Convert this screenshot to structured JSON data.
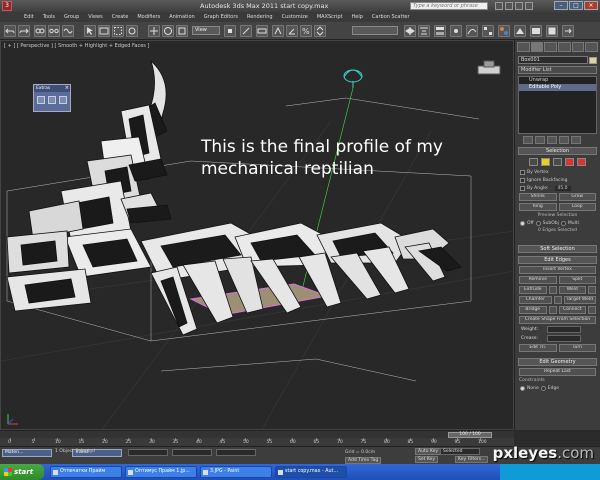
{
  "titlebar": {
    "title": "Autodesk 3ds Max  2011      start copy.max",
    "search_placeholder": "Type a keyword or phrase"
  },
  "menubar": {
    "items": [
      "Edit",
      "Tools",
      "Group",
      "Views",
      "Create",
      "Modifiers",
      "Animation",
      "Graph Editors",
      "Rendering",
      "Customize",
      "MAXScript",
      "Help",
      "Carbon Scatter"
    ]
  },
  "toolbar": {
    "view_dropdown": "View"
  },
  "viewport": {
    "label": "[ + ] [ Perspective ] [ Smooth + Highlight + Edged Faces ]",
    "overlay_line1": "This is the final profile of my",
    "overlay_line2": "mechanical reptilian",
    "extras_title": "Extras"
  },
  "command_panel": {
    "object_name": "Box001",
    "object_color": "#e1d2a0",
    "modifier_list": "Modifier List",
    "stack": [
      "Unwrap",
      "Editable Poly"
    ],
    "selection": {
      "header": "Selection",
      "by_vertex": "By Vertex",
      "ignore_backfacing": "Ignore Backfacing",
      "by_angle": "By Angle:",
      "by_angle_value": "45.0",
      "shrink": "Shrink",
      "grow": "Grow",
      "ring": "Ring",
      "loop": "Loop",
      "preview_selection": "Preview Selection",
      "off": "Off",
      "subobj": "SubObj",
      "multi": "Multi",
      "info": "0 Edges Selected"
    },
    "soft_selection": "Soft Selection",
    "edit_edges": {
      "header": "Edit Edges",
      "insert_vertex": "Insert Vertex",
      "remove": "Remove",
      "split": "Split",
      "extrude": "Extrude",
      "weld": "Weld",
      "chamfer": "Chamfer",
      "target_weld": "Target Weld",
      "bridge": "Bridge",
      "connect": "Connect",
      "create_shape": "Create Shape From Selection",
      "weight": "Weight:",
      "crease": "Crease:",
      "edit_tri": "Edit Tri.",
      "turn": "Turn"
    },
    "edit_geometry": {
      "header": "Edit Geometry",
      "repeat_last": "Repeat Last",
      "constraints": "Constraints",
      "none": "None",
      "edge": "Edge"
    }
  },
  "timeline": {
    "slider": "100 / 100",
    "ticks": [
      "0",
      "5",
      "10",
      "15",
      "20",
      "25",
      "30",
      "35",
      "40",
      "45",
      "50",
      "55",
      "60",
      "65",
      "70",
      "75",
      "80",
      "85",
      "90",
      "95",
      "100"
    ]
  },
  "statusbar": {
    "minimized1": "Materi...",
    "minimized2": "Transf...",
    "selected_text": "1 Object Selected",
    "grid": "Grid = 0.0cm",
    "auto_key": "Auto Key",
    "selected_dd": "Selected",
    "set_key": "Set Key",
    "key_filters": "Key Filters...",
    "add_time_tag": "Add Time Tag"
  },
  "taskbar": {
    "start": "start",
    "tasks": [
      "Отпечатки Прайм",
      "Оптимус Прайм 1.jp...",
      "3.JPG - Paint",
      "start copy.max - Aut..."
    ]
  },
  "watermark": {
    "text": "pxleyes",
    "suffix": ".com"
  }
}
